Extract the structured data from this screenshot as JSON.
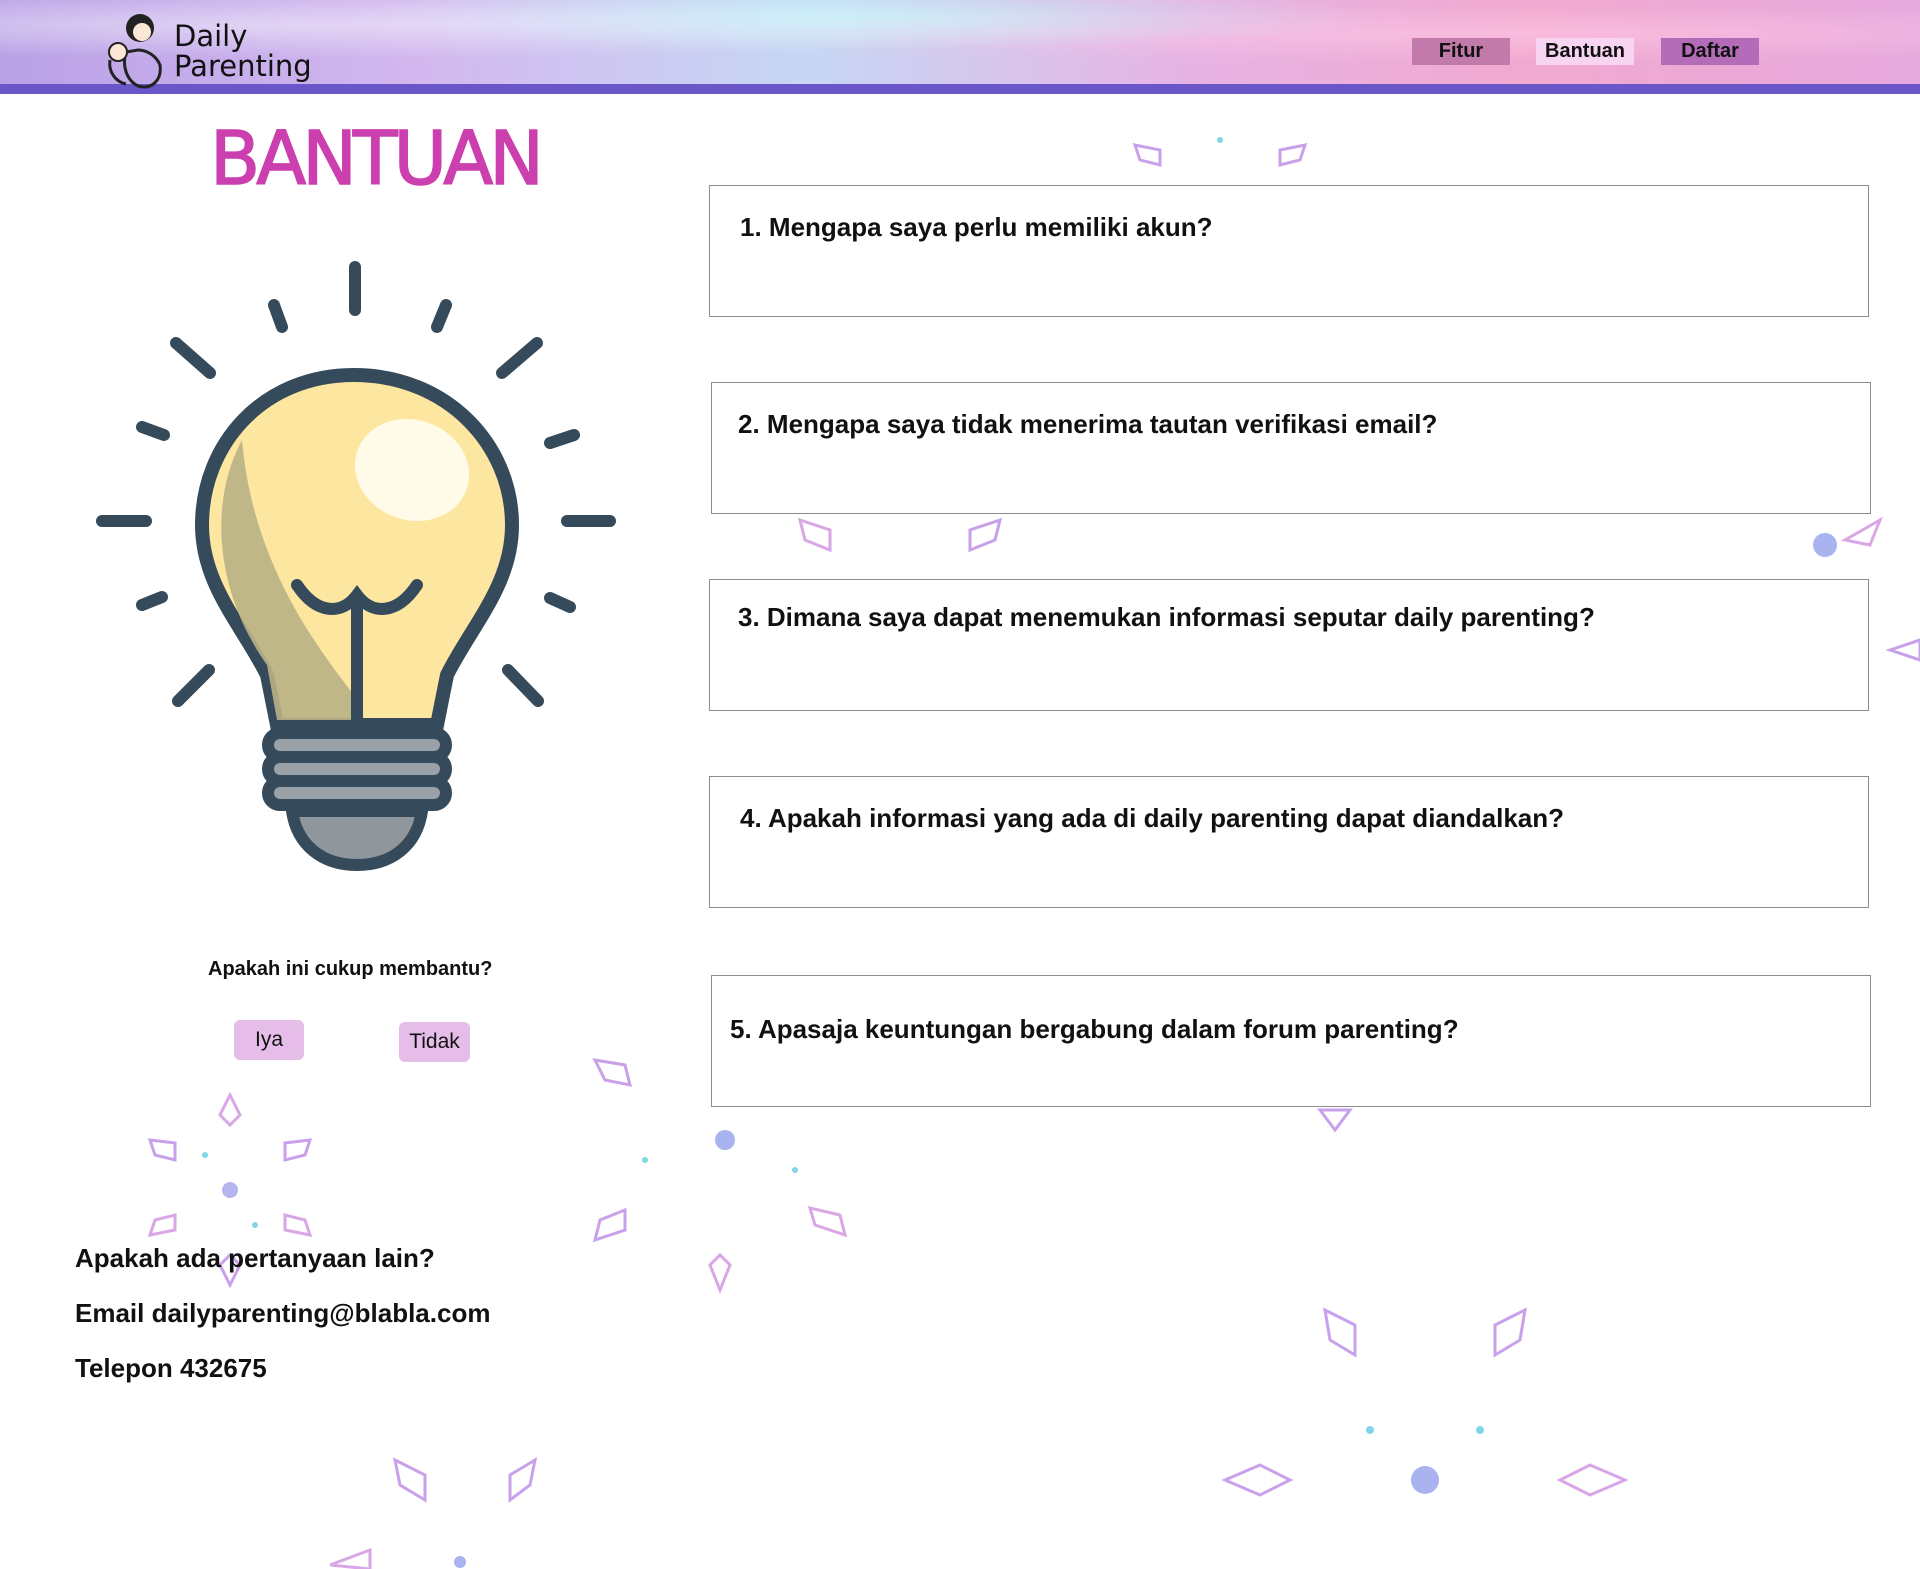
{
  "header": {
    "logo_line1": "Daily",
    "logo_line2": "Parenting",
    "nav": [
      {
        "label": "Fitur"
      },
      {
        "label": "Bantuan"
      },
      {
        "label": "Daftar"
      }
    ]
  },
  "page_title": "BANTUAN",
  "faq": [
    {
      "question": "1. Mengapa saya perlu memiliki akun?"
    },
    {
      "question": "2. Mengapa saya tidak menerima tautan verifikasi email?"
    },
    {
      "question": "3. Dimana saya dapat menemukan informasi seputar daily parenting?"
    },
    {
      "question": "4. Apakah informasi yang ada di daily parenting dapat diandalkan?"
    },
    {
      "question": "5. Apasaja keuntungan bergabung dalam forum parenting?"
    }
  ],
  "feedback": {
    "question": "Apakah ini cukup membantu?",
    "yes_label": "Iya",
    "no_label": "Tidak"
  },
  "contact": {
    "prompt": "Apakah ada pertanyaan lain?",
    "email": "Email dailyparenting@blabla.com",
    "phone": "Telepon 432675"
  },
  "colors": {
    "header_border": "#6a56c8",
    "title": "#cc3fae",
    "nav_fitur": "#c27aaa",
    "nav_bantuan": "#f6d4f2",
    "nav_daftar": "#b56cb8",
    "choice_button": "#e5bde8",
    "bulb_glass": "#fde6a0",
    "bulb_outline": "#354a5a"
  }
}
